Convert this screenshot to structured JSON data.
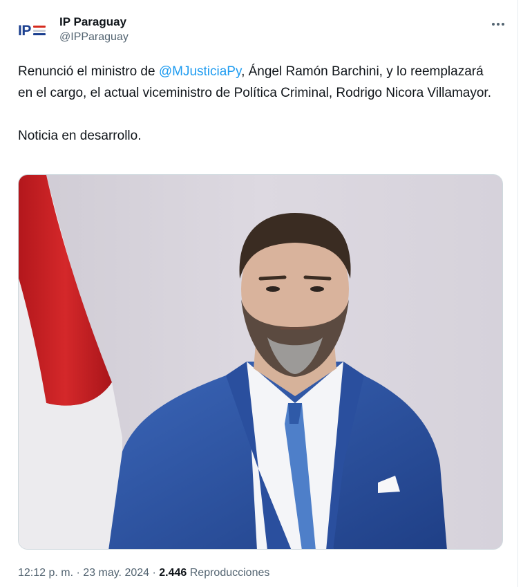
{
  "account": {
    "display_name": "IP Paraguay",
    "handle": "@IPParaguay",
    "avatar_text": "IP",
    "avatar_flag_colors": [
      "#d52b1e",
      "#ffffff",
      "#0038a8"
    ]
  },
  "tweet": {
    "text_before_mention": "Renunció el ministro de ",
    "mention": "@MJusticiaPy",
    "text_after_mention": ", Ángel Ramón Barchini, y lo reemplazará en el cargo, el actual viceministro de Política Criminal, Rodrigo Nicora Villamayor.",
    "paragraph_2": "Noticia en desarrollo."
  },
  "meta": {
    "time": "12:12 p. m.",
    "separator": " · ",
    "date": "23 may. 2024",
    "separator2": " · ",
    "views_count": "2.446",
    "views_label": " Reproducciones"
  },
  "colors": {
    "accent": "#1d9bf0",
    "text": "#0f1419",
    "secondary": "#536471",
    "brand": "#1b3f8f"
  },
  "icons": {
    "more": "more-horizontal-icon"
  }
}
